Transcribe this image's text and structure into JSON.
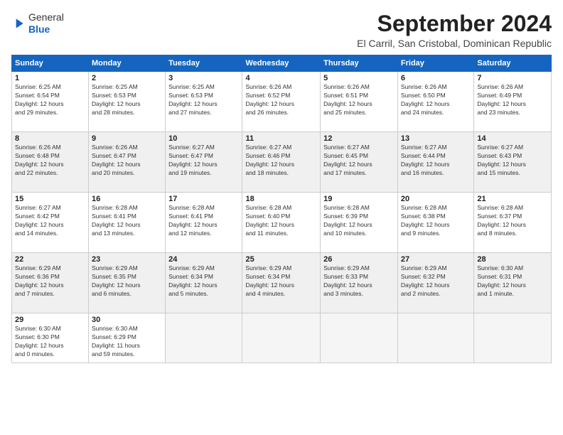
{
  "header": {
    "logo": {
      "line1": "General",
      "line2": "Blue"
    },
    "title": "September 2024",
    "location": "El Carril, San Cristobal, Dominican Republic"
  },
  "calendar": {
    "weekdays": [
      "Sunday",
      "Monday",
      "Tuesday",
      "Wednesday",
      "Thursday",
      "Friday",
      "Saturday"
    ],
    "weeks": [
      [
        {
          "day": "1",
          "sunrise": "6:25 AM",
          "sunset": "6:54 PM",
          "daylight": "12 hours and 29 minutes."
        },
        {
          "day": "2",
          "sunrise": "6:25 AM",
          "sunset": "6:53 PM",
          "daylight": "12 hours and 28 minutes."
        },
        {
          "day": "3",
          "sunrise": "6:25 AM",
          "sunset": "6:53 PM",
          "daylight": "12 hours and 27 minutes."
        },
        {
          "day": "4",
          "sunrise": "6:26 AM",
          "sunset": "6:52 PM",
          "daylight": "12 hours and 26 minutes."
        },
        {
          "day": "5",
          "sunrise": "6:26 AM",
          "sunset": "6:51 PM",
          "daylight": "12 hours and 25 minutes."
        },
        {
          "day": "6",
          "sunrise": "6:26 AM",
          "sunset": "6:50 PM",
          "daylight": "12 hours and 24 minutes."
        },
        {
          "day": "7",
          "sunrise": "6:26 AM",
          "sunset": "6:49 PM",
          "daylight": "12 hours and 23 minutes."
        }
      ],
      [
        {
          "day": "8",
          "sunrise": "6:26 AM",
          "sunset": "6:48 PM",
          "daylight": "12 hours and 22 minutes."
        },
        {
          "day": "9",
          "sunrise": "6:26 AM",
          "sunset": "6:47 PM",
          "daylight": "12 hours and 20 minutes."
        },
        {
          "day": "10",
          "sunrise": "6:27 AM",
          "sunset": "6:47 PM",
          "daylight": "12 hours and 19 minutes."
        },
        {
          "day": "11",
          "sunrise": "6:27 AM",
          "sunset": "6:46 PM",
          "daylight": "12 hours and 18 minutes."
        },
        {
          "day": "12",
          "sunrise": "6:27 AM",
          "sunset": "6:45 PM",
          "daylight": "12 hours and 17 minutes."
        },
        {
          "day": "13",
          "sunrise": "6:27 AM",
          "sunset": "6:44 PM",
          "daylight": "12 hours and 16 minutes."
        },
        {
          "day": "14",
          "sunrise": "6:27 AM",
          "sunset": "6:43 PM",
          "daylight": "12 hours and 15 minutes."
        }
      ],
      [
        {
          "day": "15",
          "sunrise": "6:27 AM",
          "sunset": "6:42 PM",
          "daylight": "12 hours and 14 minutes."
        },
        {
          "day": "16",
          "sunrise": "6:28 AM",
          "sunset": "6:41 PM",
          "daylight": "12 hours and 13 minutes."
        },
        {
          "day": "17",
          "sunrise": "6:28 AM",
          "sunset": "6:41 PM",
          "daylight": "12 hours and 12 minutes."
        },
        {
          "day": "18",
          "sunrise": "6:28 AM",
          "sunset": "6:40 PM",
          "daylight": "12 hours and 11 minutes."
        },
        {
          "day": "19",
          "sunrise": "6:28 AM",
          "sunset": "6:39 PM",
          "daylight": "12 hours and 10 minutes."
        },
        {
          "day": "20",
          "sunrise": "6:28 AM",
          "sunset": "6:38 PM",
          "daylight": "12 hours and 9 minutes."
        },
        {
          "day": "21",
          "sunrise": "6:28 AM",
          "sunset": "6:37 PM",
          "daylight": "12 hours and 8 minutes."
        }
      ],
      [
        {
          "day": "22",
          "sunrise": "6:29 AM",
          "sunset": "6:36 PM",
          "daylight": "12 hours and 7 minutes."
        },
        {
          "day": "23",
          "sunrise": "6:29 AM",
          "sunset": "6:35 PM",
          "daylight": "12 hours and 6 minutes."
        },
        {
          "day": "24",
          "sunrise": "6:29 AM",
          "sunset": "6:34 PM",
          "daylight": "12 hours and 5 minutes."
        },
        {
          "day": "25",
          "sunrise": "6:29 AM",
          "sunset": "6:34 PM",
          "daylight": "12 hours and 4 minutes."
        },
        {
          "day": "26",
          "sunrise": "6:29 AM",
          "sunset": "6:33 PM",
          "daylight": "12 hours and 3 minutes."
        },
        {
          "day": "27",
          "sunrise": "6:29 AM",
          "sunset": "6:32 PM",
          "daylight": "12 hours and 2 minutes."
        },
        {
          "day": "28",
          "sunrise": "6:30 AM",
          "sunset": "6:31 PM",
          "daylight": "12 hours and 1 minute."
        }
      ],
      [
        {
          "day": "29",
          "sunrise": "6:30 AM",
          "sunset": "6:30 PM",
          "daylight": "12 hours and 0 minutes."
        },
        {
          "day": "30",
          "sunrise": "6:30 AM",
          "sunset": "6:29 PM",
          "daylight": "11 hours and 59 minutes."
        },
        null,
        null,
        null,
        null,
        null
      ]
    ]
  }
}
